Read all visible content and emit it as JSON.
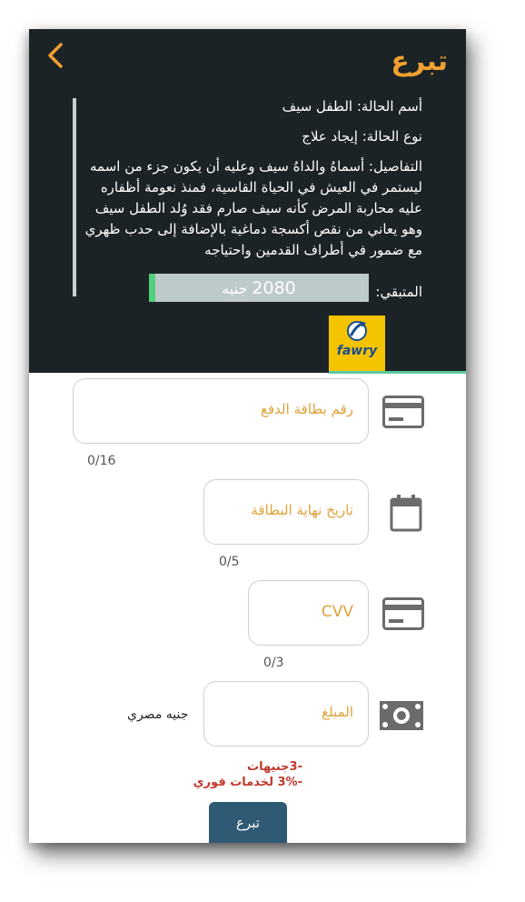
{
  "header": {
    "title": "تبرع",
    "back_icon": "chevron-left-icon",
    "case_name_label": "أسم الحالة:",
    "case_name": "الطفل سيف",
    "case_type_label": "نوع الحالة:",
    "case_type": "إيجاد علاج",
    "details_label": "التفاصيل:",
    "details": "أسماهُ والداهُ سيف وعليه أن يكون جزء من اسمه ليستمر في العيش في الحياة القاسية، فمنذ نعومة أظفاره عليه محاربة المرض كأنه سيف صارم فقد وُلد الطفل سيف وهو يعاني من نقص أكسجة دماغية بالإضافة إلى حدب ظهري مع ضمور في أطراف القدمين واحتياجه",
    "remaining_label": "المتبقي:",
    "remaining_amount": "2080",
    "remaining_currency": "جنيه",
    "remaining_fraction": 0.03
  },
  "payment": {
    "fawry_label": "fawry",
    "accent": "#f0a030",
    "card_number_placeholder": "رقم بطاقة الدفع",
    "card_number_counter": "0/16",
    "expiry_placeholder": "تاريخ نهاية البطاقة",
    "expiry_counter": "0/5",
    "cvv_placeholder": "CVV",
    "cvv_counter": "0/3",
    "amount_placeholder": "المبلغ",
    "currency_label": "جنيه مصري",
    "fee_line_1": "-3جنيهات",
    "fee_line_2": "-3% لخدمات فوري",
    "fee_color": "#c0392b",
    "donate_button": "تبرع"
  }
}
